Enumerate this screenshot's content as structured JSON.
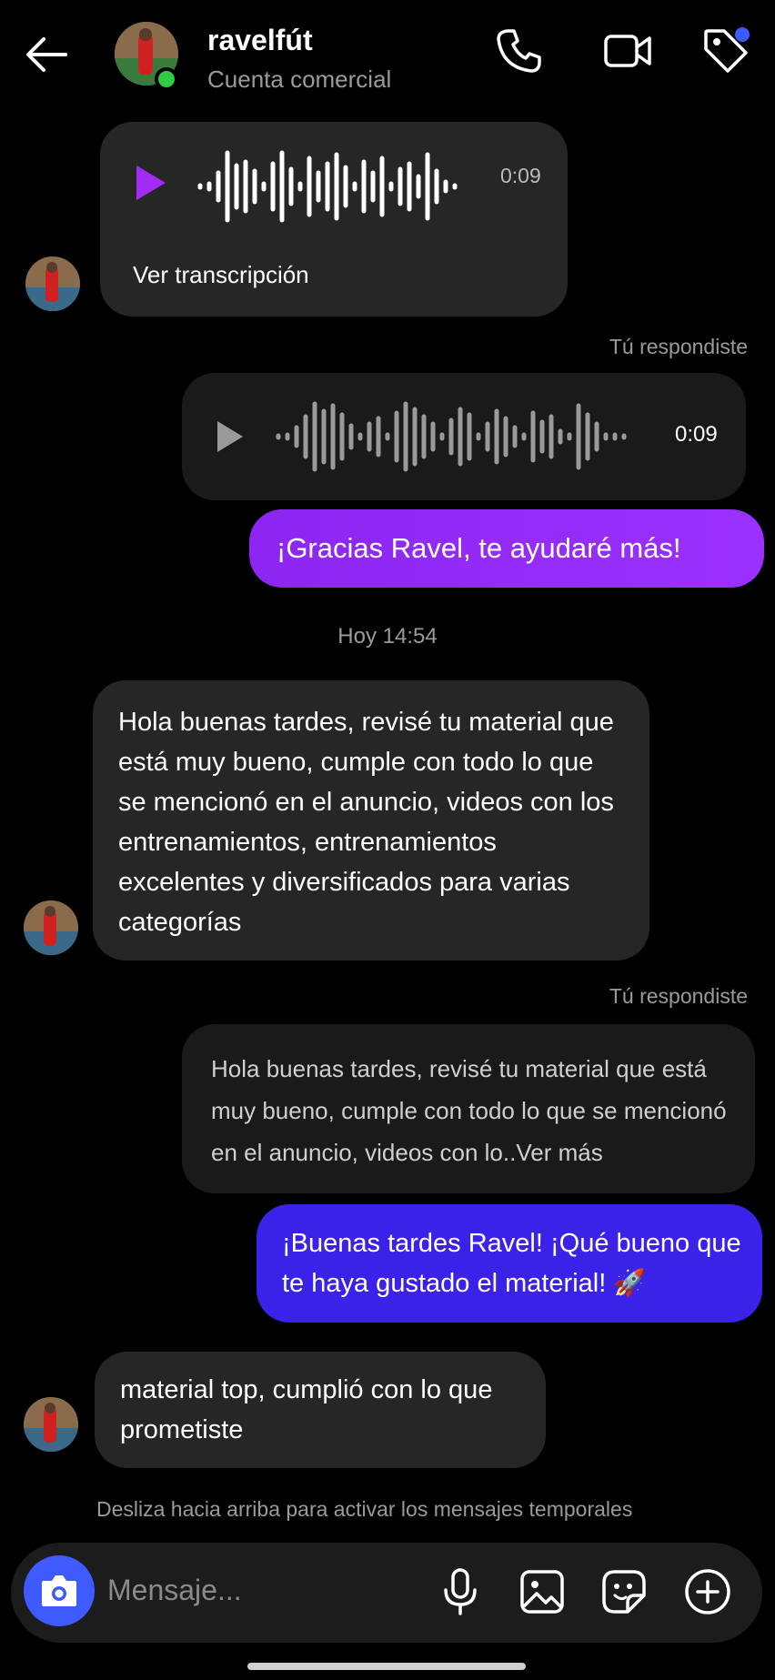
{
  "header": {
    "name": "ravelfút",
    "subtitle": "Cuenta comercial",
    "icons": [
      "back-arrow-icon",
      "phone-icon",
      "video-camera-icon",
      "tag-icon"
    ]
  },
  "messages": {
    "voice_received_duration": "0:09",
    "voice_received_transcript": "Ver transcripción",
    "reply_label_1": "Tú respondiste",
    "voice_sent_duration": "0:09",
    "sent_1": "¡Gracias Ravel, te ayudaré más!",
    "timestamp": "Hoy 14:54",
    "received_2": "Hola buenas tardes, revisé tu material que está muy bueno, cumple con todo lo que se mencionó en el anuncio, videos con los entrenamientos, entrenamientos excelentes y diversificados para varias categorías",
    "reply_label_2": "Tú respondiste",
    "quoted_reply": "Hola buenas tardes, revisé tu material que está muy bueno, cumple con todo lo que se mencionó en el anuncio, videos con lo..Ver más",
    "sent_2": "¡Buenas tardes Ravel! ¡Qué bueno que te haya gustado el material! 🚀",
    "received_3": "material top, cumplió con lo que prometiste",
    "vanish_hint": "Desliza hacia arriba para activar los mensajes temporales"
  },
  "composer": {
    "placeholder": "Mensaje...",
    "icons": [
      "camera-icon",
      "microphone-icon",
      "image-icon",
      "sticker-icon",
      "plus-icon"
    ]
  },
  "colors": {
    "sent_purple": "#9b30ff",
    "sent_blue": "#3a22e8",
    "received_bg": "#262626",
    "camera_button": "#3f5bff",
    "online": "#2ecc40"
  }
}
